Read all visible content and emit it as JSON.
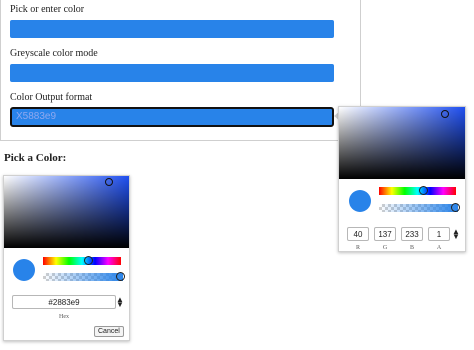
{
  "form": {
    "pick_label": "Pick or enter color",
    "greyscale_label": "Greyscale color mode",
    "output_label": "Color Output format",
    "output_value": "X5883e9"
  },
  "section_heading": "Pick a Color:",
  "popup_picker": {
    "color": "#2883e9",
    "values": [
      "40",
      "137",
      "233",
      "1"
    ],
    "value_labels": [
      "R",
      "G",
      "B",
      "A"
    ]
  },
  "inline_picker": {
    "color": "#2883e9",
    "hex_value": "#2883e9",
    "hex_label": "Hex",
    "cancel_label": "Cancel"
  },
  "icons": {
    "format_toggle": "up-down-arrows-icon"
  }
}
